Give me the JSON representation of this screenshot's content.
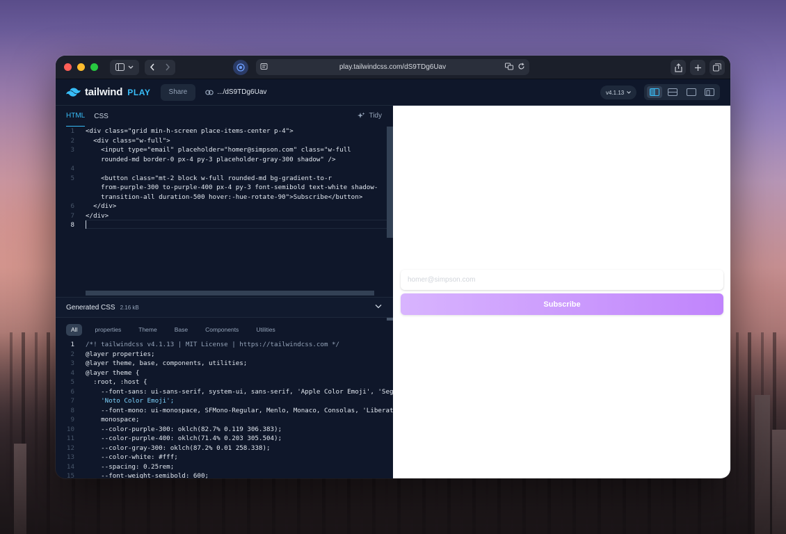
{
  "browser": {
    "url": "play.tailwindcss.com/dS9TDg6Uav"
  },
  "header": {
    "logo_word": "tailwind",
    "logo_play": "PLAY",
    "share_label": "Share",
    "share_path": ".../dS9TDg6Uav",
    "version": "v4.1.13"
  },
  "editor": {
    "tabs": [
      {
        "label": "HTML",
        "active": true
      },
      {
        "label": "CSS",
        "active": false
      }
    ],
    "tidy_label": "Tidy",
    "line_numbers": [
      "1",
      "2",
      "3",
      "",
      "4",
      "5",
      "",
      "",
      "6",
      "7",
      "8"
    ],
    "lines": [
      "<div class=\"grid min-h-screen place-items-center p-4\">",
      "  <div class=\"w-full\">",
      "    <input type=\"email\" placeholder=\"homer@simpson.com\" class=\"w-full",
      "    rounded-md border-0 px-4 py-3 placeholder-gray-300 shadow\" />",
      "",
      "    <button class=\"mt-2 block w-full rounded-md bg-gradient-to-r",
      "    from-purple-300 to-purple-400 px-4 py-3 font-semibold text-white shadow-",
      "    transition-all duration-500 hover:-hue-rotate-90\">Subscribe</button>",
      "  </div>",
      "</div>",
      ""
    ]
  },
  "generated": {
    "title": "Generated CSS",
    "size": "2.16 kB",
    "filters": [
      {
        "label": "All",
        "active": true
      },
      {
        "label": "properties",
        "active": false
      },
      {
        "label": "Theme",
        "active": false
      },
      {
        "label": "Base",
        "active": false
      },
      {
        "label": "Components",
        "active": false
      },
      {
        "label": "Utilities",
        "active": false
      }
    ],
    "line_numbers": [
      "1",
      "2",
      "3",
      "4",
      "5",
      "6",
      "7",
      "8",
      "9",
      "10",
      "11",
      "12",
      "13",
      "14",
      "15"
    ],
    "lines": [
      "/*! tailwindcss v4.1.13 | MIT License | https://tailwindcss.com */",
      "@layer properties;",
      "@layer theme, base, components, utilities;",
      "@layer theme {",
      "  :root, :host {",
      "    --font-sans: ui-sans-serif, system-ui, sans-serif, 'Apple Color Emoji', 'Segoe",
      "    'Noto Color Emoji';",
      "    --font-mono: ui-monospace, SFMono-Regular, Menlo, Monaco, Consolas, 'Liberatio",
      "    monospace;",
      "    --color-purple-300: oklch(82.7% 0.119 306.383);",
      "    --color-purple-400: oklch(71.4% 0.203 305.504);",
      "    --color-gray-300: oklch(87.2% 0.01 258.338);",
      "    --color-white: #fff;",
      "    --spacing: 0.25rem;",
      "    --font-weight-semibold: 600;"
    ]
  },
  "preview": {
    "email_placeholder": "homer@simpson.com",
    "button_label": "Subscribe"
  },
  "colors": {
    "purple_300": "#d8b4fe",
    "purple_400": "#c084fc",
    "gray_300": "#d1d5db",
    "accent": "#38bdf8"
  }
}
